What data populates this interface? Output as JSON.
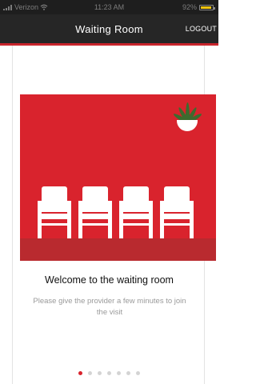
{
  "status_bar": {
    "carrier": "Verizon",
    "time": "11:23 AM",
    "battery_percent": "92%",
    "battery_level": 0.92,
    "battery_color": "#f1c40f",
    "wifi_icon": "wifi-icon",
    "signal_icon": "signal-bars-icon"
  },
  "nav": {
    "title": "Waiting Room",
    "logout_label": "LOGOUT"
  },
  "colors": {
    "brand_red": "#d9232d",
    "nav_background": "#262626",
    "accent_line": "#c9252c"
  },
  "illustration": {
    "chairs": 4,
    "plant_icon": "potted-plant-icon",
    "chair_icon": "chair-icon"
  },
  "content": {
    "heading": "Welcome to the waiting room",
    "message": "Please give the provider a few minutes to join the visit"
  },
  "pager": {
    "total": 7,
    "active_index": 0
  }
}
